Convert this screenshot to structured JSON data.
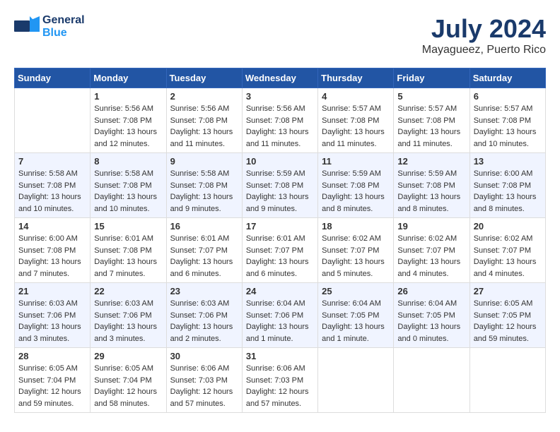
{
  "header": {
    "logo_line1": "General",
    "logo_line2": "Blue",
    "month": "July 2024",
    "location": "Mayagueez, Puerto Rico"
  },
  "weekdays": [
    "Sunday",
    "Monday",
    "Tuesday",
    "Wednesday",
    "Thursday",
    "Friday",
    "Saturday"
  ],
  "weeks": [
    [
      {
        "day": "",
        "sunrise": "",
        "sunset": "",
        "daylight": ""
      },
      {
        "day": "1",
        "sunrise": "Sunrise: 5:56 AM",
        "sunset": "Sunset: 7:08 PM",
        "daylight": "Daylight: 13 hours and 12 minutes."
      },
      {
        "day": "2",
        "sunrise": "Sunrise: 5:56 AM",
        "sunset": "Sunset: 7:08 PM",
        "daylight": "Daylight: 13 hours and 11 minutes."
      },
      {
        "day": "3",
        "sunrise": "Sunrise: 5:56 AM",
        "sunset": "Sunset: 7:08 PM",
        "daylight": "Daylight: 13 hours and 11 minutes."
      },
      {
        "day": "4",
        "sunrise": "Sunrise: 5:57 AM",
        "sunset": "Sunset: 7:08 PM",
        "daylight": "Daylight: 13 hours and 11 minutes."
      },
      {
        "day": "5",
        "sunrise": "Sunrise: 5:57 AM",
        "sunset": "Sunset: 7:08 PM",
        "daylight": "Daylight: 13 hours and 11 minutes."
      },
      {
        "day": "6",
        "sunrise": "Sunrise: 5:57 AM",
        "sunset": "Sunset: 7:08 PM",
        "daylight": "Daylight: 13 hours and 10 minutes."
      }
    ],
    [
      {
        "day": "7",
        "sunrise": "Sunrise: 5:58 AM",
        "sunset": "Sunset: 7:08 PM",
        "daylight": "Daylight: 13 hours and 10 minutes."
      },
      {
        "day": "8",
        "sunrise": "Sunrise: 5:58 AM",
        "sunset": "Sunset: 7:08 PM",
        "daylight": "Daylight: 13 hours and 10 minutes."
      },
      {
        "day": "9",
        "sunrise": "Sunrise: 5:58 AM",
        "sunset": "Sunset: 7:08 PM",
        "daylight": "Daylight: 13 hours and 9 minutes."
      },
      {
        "day": "10",
        "sunrise": "Sunrise: 5:59 AM",
        "sunset": "Sunset: 7:08 PM",
        "daylight": "Daylight: 13 hours and 9 minutes."
      },
      {
        "day": "11",
        "sunrise": "Sunrise: 5:59 AM",
        "sunset": "Sunset: 7:08 PM",
        "daylight": "Daylight: 13 hours and 8 minutes."
      },
      {
        "day": "12",
        "sunrise": "Sunrise: 5:59 AM",
        "sunset": "Sunset: 7:08 PM",
        "daylight": "Daylight: 13 hours and 8 minutes."
      },
      {
        "day": "13",
        "sunrise": "Sunrise: 6:00 AM",
        "sunset": "Sunset: 7:08 PM",
        "daylight": "Daylight: 13 hours and 8 minutes."
      }
    ],
    [
      {
        "day": "14",
        "sunrise": "Sunrise: 6:00 AM",
        "sunset": "Sunset: 7:08 PM",
        "daylight": "Daylight: 13 hours and 7 minutes."
      },
      {
        "day": "15",
        "sunrise": "Sunrise: 6:01 AM",
        "sunset": "Sunset: 7:08 PM",
        "daylight": "Daylight: 13 hours and 7 minutes."
      },
      {
        "day": "16",
        "sunrise": "Sunrise: 6:01 AM",
        "sunset": "Sunset: 7:07 PM",
        "daylight": "Daylight: 13 hours and 6 minutes."
      },
      {
        "day": "17",
        "sunrise": "Sunrise: 6:01 AM",
        "sunset": "Sunset: 7:07 PM",
        "daylight": "Daylight: 13 hours and 6 minutes."
      },
      {
        "day": "18",
        "sunrise": "Sunrise: 6:02 AM",
        "sunset": "Sunset: 7:07 PM",
        "daylight": "Daylight: 13 hours and 5 minutes."
      },
      {
        "day": "19",
        "sunrise": "Sunrise: 6:02 AM",
        "sunset": "Sunset: 7:07 PM",
        "daylight": "Daylight: 13 hours and 4 minutes."
      },
      {
        "day": "20",
        "sunrise": "Sunrise: 6:02 AM",
        "sunset": "Sunset: 7:07 PM",
        "daylight": "Daylight: 13 hours and 4 minutes."
      }
    ],
    [
      {
        "day": "21",
        "sunrise": "Sunrise: 6:03 AM",
        "sunset": "Sunset: 7:06 PM",
        "daylight": "Daylight: 13 hours and 3 minutes."
      },
      {
        "day": "22",
        "sunrise": "Sunrise: 6:03 AM",
        "sunset": "Sunset: 7:06 PM",
        "daylight": "Daylight: 13 hours and 3 minutes."
      },
      {
        "day": "23",
        "sunrise": "Sunrise: 6:03 AM",
        "sunset": "Sunset: 7:06 PM",
        "daylight": "Daylight: 13 hours and 2 minutes."
      },
      {
        "day": "24",
        "sunrise": "Sunrise: 6:04 AM",
        "sunset": "Sunset: 7:06 PM",
        "daylight": "Daylight: 13 hours and 1 minute."
      },
      {
        "day": "25",
        "sunrise": "Sunrise: 6:04 AM",
        "sunset": "Sunset: 7:05 PM",
        "daylight": "Daylight: 13 hours and 1 minute."
      },
      {
        "day": "26",
        "sunrise": "Sunrise: 6:04 AM",
        "sunset": "Sunset: 7:05 PM",
        "daylight": "Daylight: 13 hours and 0 minutes."
      },
      {
        "day": "27",
        "sunrise": "Sunrise: 6:05 AM",
        "sunset": "Sunset: 7:05 PM",
        "daylight": "Daylight: 12 hours and 59 minutes."
      }
    ],
    [
      {
        "day": "28",
        "sunrise": "Sunrise: 6:05 AM",
        "sunset": "Sunset: 7:04 PM",
        "daylight": "Daylight: 12 hours and 59 minutes."
      },
      {
        "day": "29",
        "sunrise": "Sunrise: 6:05 AM",
        "sunset": "Sunset: 7:04 PM",
        "daylight": "Daylight: 12 hours and 58 minutes."
      },
      {
        "day": "30",
        "sunrise": "Sunrise: 6:06 AM",
        "sunset": "Sunset: 7:03 PM",
        "daylight": "Daylight: 12 hours and 57 minutes."
      },
      {
        "day": "31",
        "sunrise": "Sunrise: 6:06 AM",
        "sunset": "Sunset: 7:03 PM",
        "daylight": "Daylight: 12 hours and 57 minutes."
      },
      {
        "day": "",
        "sunrise": "",
        "sunset": "",
        "daylight": ""
      },
      {
        "day": "",
        "sunrise": "",
        "sunset": "",
        "daylight": ""
      },
      {
        "day": "",
        "sunrise": "",
        "sunset": "",
        "daylight": ""
      }
    ]
  ]
}
